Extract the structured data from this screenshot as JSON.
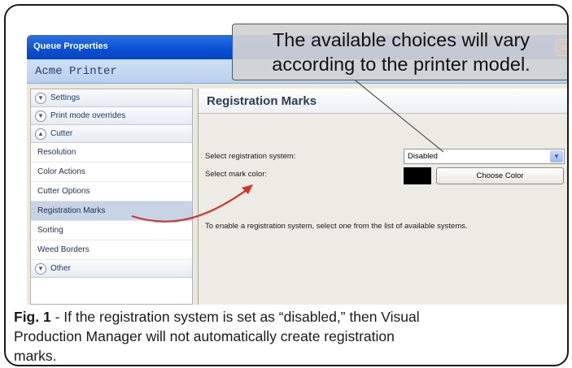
{
  "window": {
    "title": "Queue Properties",
    "printer_name": "Acme Printer",
    "close_glyph": "×"
  },
  "sidebar": {
    "settings": "Settings",
    "print_mode_overrides": "Print mode overrides",
    "cutter": "Cutter",
    "cutter_items": [
      "Resolution",
      "Color Actions",
      "Cutter Options",
      "Registration Marks",
      "Sorting",
      "Weed Borders"
    ],
    "selected_item": "Registration Marks",
    "other": "Other"
  },
  "content": {
    "title": "Registration Marks",
    "select_system_label": "Select registration system:",
    "select_system_value": "Disabled",
    "select_color_label": "Select mark color:",
    "mark_color": "#000000",
    "choose_color_button": "Choose Color",
    "hint": "To enable a registration system, select one from the list of available systems."
  },
  "callout": {
    "line1": "The available choices will vary",
    "line2": "according to the printer model."
  },
  "caption": {
    "label": "Fig. 1",
    "text_line1": " - If the registration system is set as “disabled,” then Visual",
    "text_line2": "Production Manager will not automatically create registration",
    "text_line3": "marks."
  },
  "colors": {
    "titlebar": "#0a4fd3",
    "annotation_arrow": "#d9322b",
    "selection": "#c8d3e6"
  },
  "icons": {
    "expand": "chevron-down-icon",
    "collapse": "chevron-up-icon",
    "dropdown": "chevron-down-icon"
  }
}
